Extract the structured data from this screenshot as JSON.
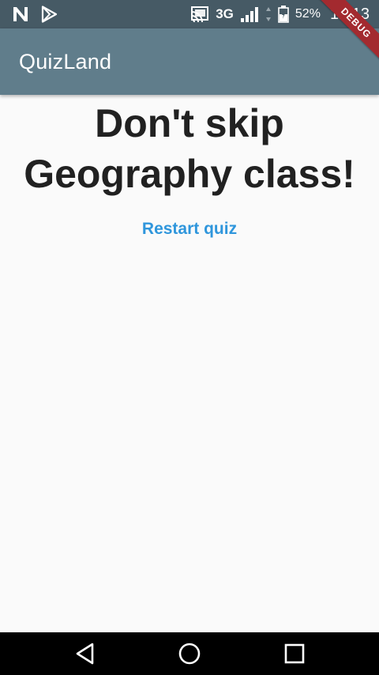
{
  "status_bar": {
    "network": "3G",
    "battery": "52%",
    "time": "12:13",
    "icons": {
      "left": [
        "n-logo-icon",
        "play-store-icon"
      ],
      "right": [
        "cast-icon",
        "signal-icon",
        "data-arrows-icon",
        "battery-icon"
      ]
    },
    "colors": {
      "background": "#465a65",
      "foreground": "#ffffff"
    }
  },
  "app_bar": {
    "title": "QuizLand",
    "color": "#607d8b"
  },
  "debug_banner": {
    "label": "DEBUG",
    "color": "#a32a2f"
  },
  "main": {
    "message": "Don't skip Geography class!",
    "restart_label": "Restart quiz",
    "accent": "#2f96dc"
  },
  "nav_bar": {
    "icons": [
      "back-icon",
      "home-icon",
      "recent-apps-icon"
    ]
  }
}
